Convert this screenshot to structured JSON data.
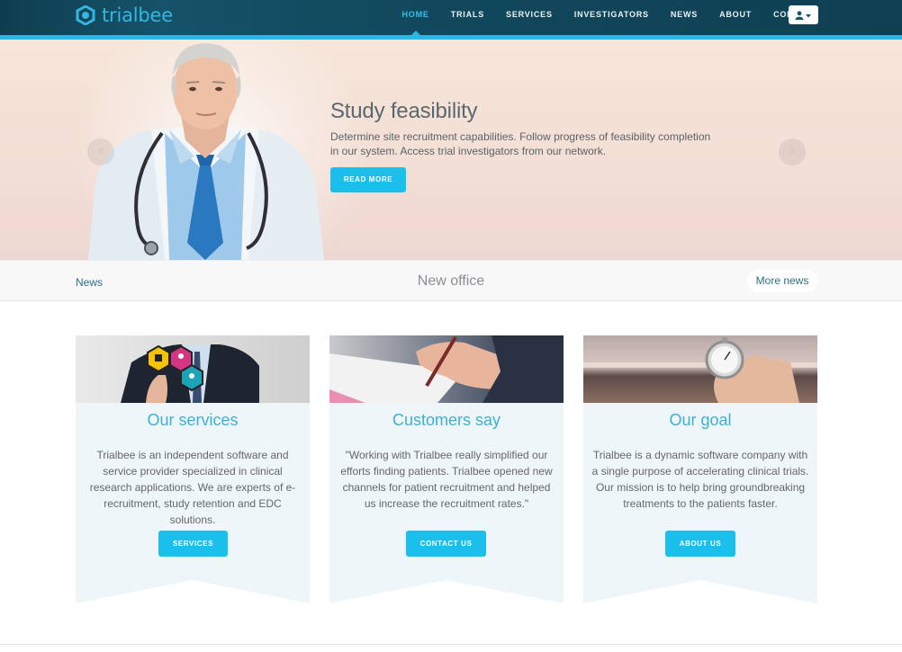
{
  "brand": {
    "name": "trialbee"
  },
  "nav": {
    "items": [
      {
        "label": "HOME"
      },
      {
        "label": "TRIALS"
      },
      {
        "label": "SERVICES"
      },
      {
        "label": "INVESTIGATORS"
      },
      {
        "label": "NEWS"
      },
      {
        "label": "ABOUT"
      },
      {
        "label": "CONTACT"
      }
    ],
    "active_index": 0,
    "user_button_icon": "user-dropdown-icon"
  },
  "hero": {
    "title": "Study feasibility",
    "text": "Determine site recruitment capabilities. Follow progress of feasibility completion in our system. Access trial investigators from our network.",
    "button": "READ MORE",
    "prev_icon": "‹",
    "next_icon": "›"
  },
  "newsbar": {
    "label": "News",
    "headline": "New office",
    "more_button": "More news"
  },
  "cards": [
    {
      "title": "Our services",
      "text": "Trialbee is an independent software and service provider specialized in clinical research applications. We are experts of e-recruitment, study retention and EDC solutions.",
      "button": "SERVICES"
    },
    {
      "title": "Customers say",
      "text": "\"Working with Trialbee really simplified our efforts finding patients. Trialbee opened new channels for patient recruitment and helped us increase the recruitment rates.\"",
      "button": "CONTACT US"
    },
    {
      "title": "Our goal",
      "text": "Trialbee is a dynamic software company with a single purpose of accelerating clinical trials. Our mission is to help bring groundbreaking treatments to the patients faster.",
      "button": "ABOUT US"
    }
  ],
  "colors": {
    "accent": "#1bbfeb",
    "nav_bg": "#124a5f",
    "card_bg": "#eef6fa",
    "title_blue": "#3cb0d4"
  }
}
